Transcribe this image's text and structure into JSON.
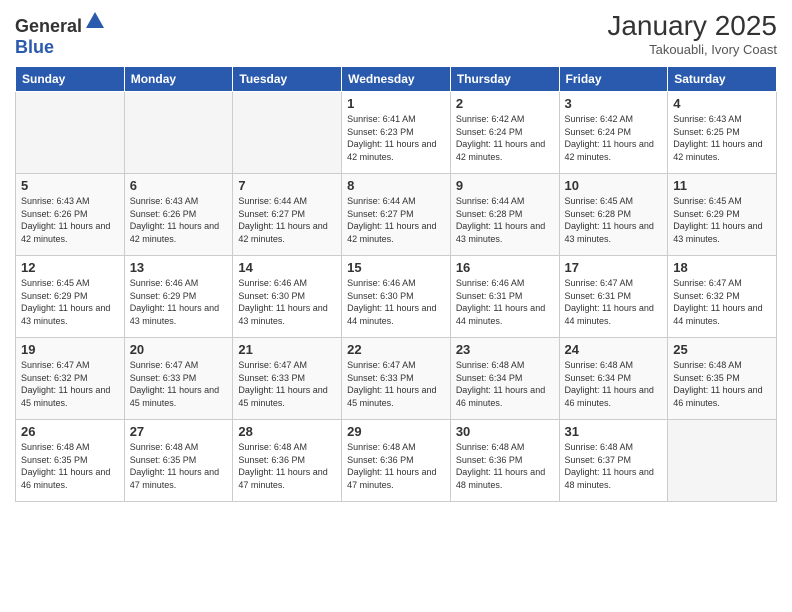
{
  "header": {
    "logo_general": "General",
    "logo_blue": "Blue",
    "month_year": "January 2025",
    "location": "Takouabli, Ivory Coast"
  },
  "weekdays": [
    "Sunday",
    "Monday",
    "Tuesday",
    "Wednesday",
    "Thursday",
    "Friday",
    "Saturday"
  ],
  "weeks": [
    [
      {
        "day": "",
        "empty": true
      },
      {
        "day": "",
        "empty": true
      },
      {
        "day": "",
        "empty": true
      },
      {
        "day": "1",
        "sunrise": "6:41 AM",
        "sunset": "6:23 PM",
        "daylight": "11 hours and 42 minutes."
      },
      {
        "day": "2",
        "sunrise": "6:42 AM",
        "sunset": "6:24 PM",
        "daylight": "11 hours and 42 minutes."
      },
      {
        "day": "3",
        "sunrise": "6:42 AM",
        "sunset": "6:24 PM",
        "daylight": "11 hours and 42 minutes."
      },
      {
        "day": "4",
        "sunrise": "6:43 AM",
        "sunset": "6:25 PM",
        "daylight": "11 hours and 42 minutes."
      }
    ],
    [
      {
        "day": "5",
        "sunrise": "6:43 AM",
        "sunset": "6:26 PM",
        "daylight": "11 hours and 42 minutes."
      },
      {
        "day": "6",
        "sunrise": "6:43 AM",
        "sunset": "6:26 PM",
        "daylight": "11 hours and 42 minutes."
      },
      {
        "day": "7",
        "sunrise": "6:44 AM",
        "sunset": "6:27 PM",
        "daylight": "11 hours and 42 minutes."
      },
      {
        "day": "8",
        "sunrise": "6:44 AM",
        "sunset": "6:27 PM",
        "daylight": "11 hours and 42 minutes."
      },
      {
        "day": "9",
        "sunrise": "6:44 AM",
        "sunset": "6:28 PM",
        "daylight": "11 hours and 43 minutes."
      },
      {
        "day": "10",
        "sunrise": "6:45 AM",
        "sunset": "6:28 PM",
        "daylight": "11 hours and 43 minutes."
      },
      {
        "day": "11",
        "sunrise": "6:45 AM",
        "sunset": "6:29 PM",
        "daylight": "11 hours and 43 minutes."
      }
    ],
    [
      {
        "day": "12",
        "sunrise": "6:45 AM",
        "sunset": "6:29 PM",
        "daylight": "11 hours and 43 minutes."
      },
      {
        "day": "13",
        "sunrise": "6:46 AM",
        "sunset": "6:29 PM",
        "daylight": "11 hours and 43 minutes."
      },
      {
        "day": "14",
        "sunrise": "6:46 AM",
        "sunset": "6:30 PM",
        "daylight": "11 hours and 43 minutes."
      },
      {
        "day": "15",
        "sunrise": "6:46 AM",
        "sunset": "6:30 PM",
        "daylight": "11 hours and 44 minutes."
      },
      {
        "day": "16",
        "sunrise": "6:46 AM",
        "sunset": "6:31 PM",
        "daylight": "11 hours and 44 minutes."
      },
      {
        "day": "17",
        "sunrise": "6:47 AM",
        "sunset": "6:31 PM",
        "daylight": "11 hours and 44 minutes."
      },
      {
        "day": "18",
        "sunrise": "6:47 AM",
        "sunset": "6:32 PM",
        "daylight": "11 hours and 44 minutes."
      }
    ],
    [
      {
        "day": "19",
        "sunrise": "6:47 AM",
        "sunset": "6:32 PM",
        "daylight": "11 hours and 45 minutes."
      },
      {
        "day": "20",
        "sunrise": "6:47 AM",
        "sunset": "6:33 PM",
        "daylight": "11 hours and 45 minutes."
      },
      {
        "day": "21",
        "sunrise": "6:47 AM",
        "sunset": "6:33 PM",
        "daylight": "11 hours and 45 minutes."
      },
      {
        "day": "22",
        "sunrise": "6:47 AM",
        "sunset": "6:33 PM",
        "daylight": "11 hours and 45 minutes."
      },
      {
        "day": "23",
        "sunrise": "6:48 AM",
        "sunset": "6:34 PM",
        "daylight": "11 hours and 46 minutes."
      },
      {
        "day": "24",
        "sunrise": "6:48 AM",
        "sunset": "6:34 PM",
        "daylight": "11 hours and 46 minutes."
      },
      {
        "day": "25",
        "sunrise": "6:48 AM",
        "sunset": "6:35 PM",
        "daylight": "11 hours and 46 minutes."
      }
    ],
    [
      {
        "day": "26",
        "sunrise": "6:48 AM",
        "sunset": "6:35 PM",
        "daylight": "11 hours and 46 minutes."
      },
      {
        "day": "27",
        "sunrise": "6:48 AM",
        "sunset": "6:35 PM",
        "daylight": "11 hours and 47 minutes."
      },
      {
        "day": "28",
        "sunrise": "6:48 AM",
        "sunset": "6:36 PM",
        "daylight": "11 hours and 47 minutes."
      },
      {
        "day": "29",
        "sunrise": "6:48 AM",
        "sunset": "6:36 PM",
        "daylight": "11 hours and 47 minutes."
      },
      {
        "day": "30",
        "sunrise": "6:48 AM",
        "sunset": "6:36 PM",
        "daylight": "11 hours and 48 minutes."
      },
      {
        "day": "31",
        "sunrise": "6:48 AM",
        "sunset": "6:37 PM",
        "daylight": "11 hours and 48 minutes."
      },
      {
        "day": "",
        "empty": true
      }
    ]
  ],
  "labels": {
    "sunrise": "Sunrise:",
    "sunset": "Sunset:",
    "daylight": "Daylight:"
  }
}
